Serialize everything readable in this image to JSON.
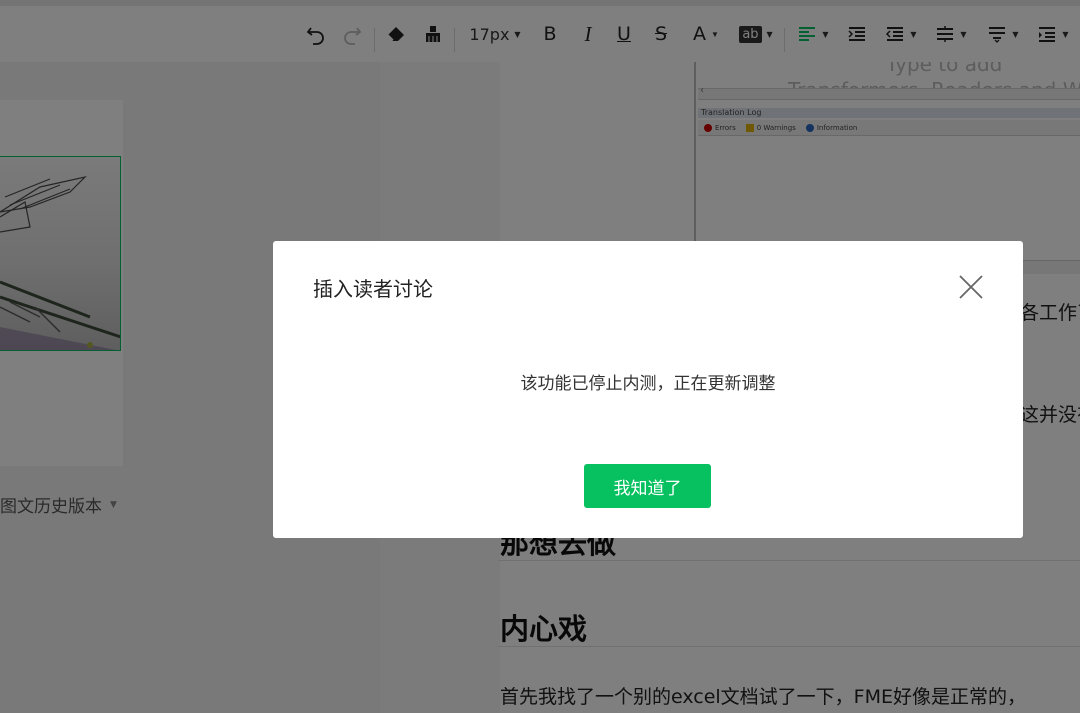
{
  "toolbar": {
    "font_size": "17px",
    "bold": "B",
    "italic": "I",
    "underline": "U",
    "strike": "S",
    "font_color": "A",
    "highlight": "ab"
  },
  "left": {
    "history_label": "图文历史版本"
  },
  "editor": {
    "shot": {
      "faded_line_1": "Type to add",
      "faded_line_2": "Transformers, Readers and Writers",
      "log_title": "Translation Log",
      "errors": "Errors",
      "warnings": "0 Warnings",
      "information": "Information"
    },
    "para_1": "各工作了",
    "para_2": "这并没有",
    "heading_1": "那想去做",
    "heading_2": "内心戏",
    "para_3": "首先我找了一个别的excel文档试了一下，FME好像是正常的，"
  },
  "dialog": {
    "title": "插入读者讨论",
    "message": "该功能已停止内测，正在更新调整",
    "confirm": "我知道了"
  },
  "colors": {
    "primary": "#07c160",
    "mask": "rgba(0,0,0,0.5)"
  }
}
